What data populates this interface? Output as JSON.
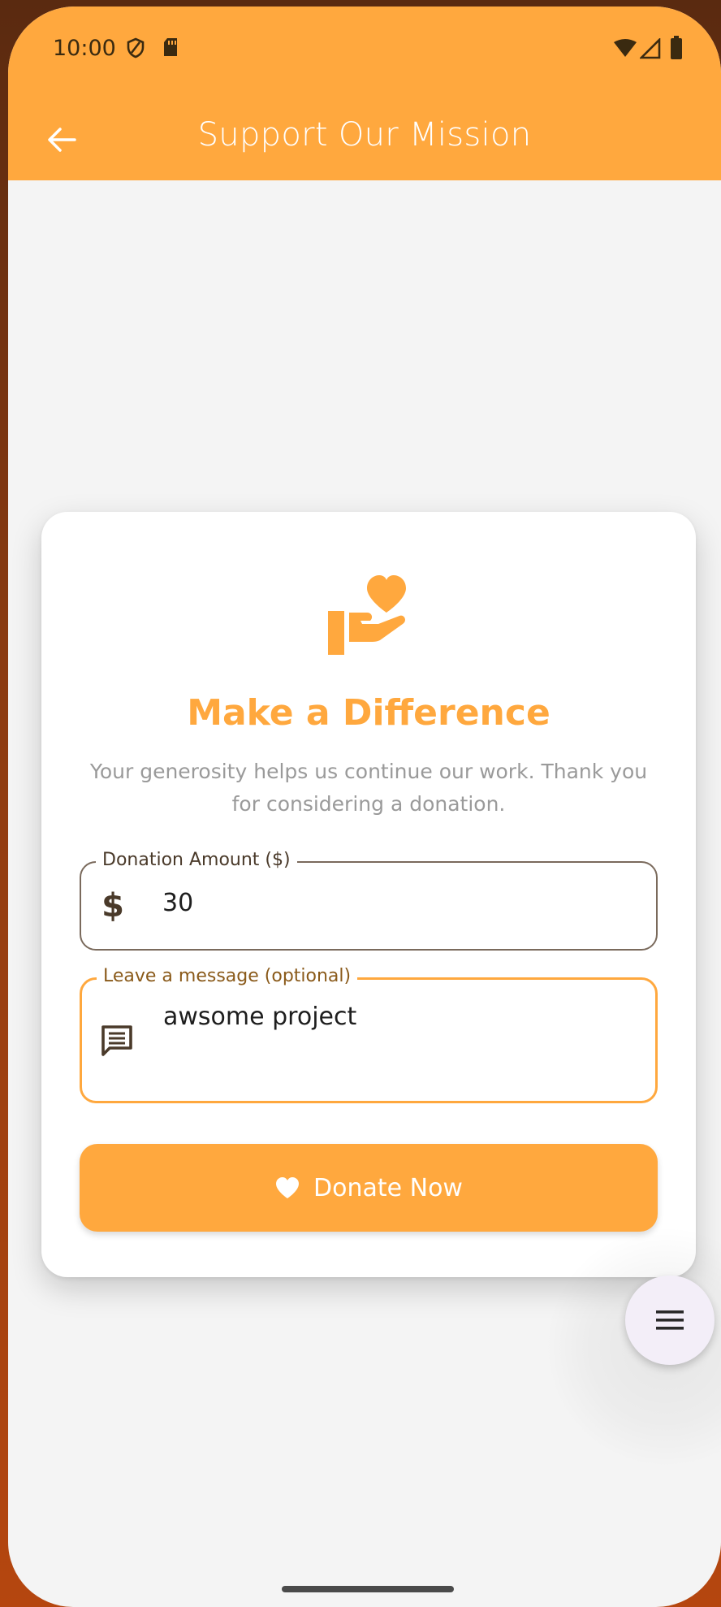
{
  "status_bar": {
    "time": "10:00"
  },
  "app_bar": {
    "title": "Support Our Mission",
    "background_color": "#ffa83e"
  },
  "card": {
    "hero_icon": "volunteer-heart-hand-icon",
    "heading": "Make a Difference",
    "subtitle": "Your generosity helps us continue our work. Thank you for considering a donation.",
    "amount_field": {
      "label": "Donation Amount ($)",
      "prefix_icon": "dollar-icon",
      "value": "30"
    },
    "message_field": {
      "label": "Leave a message (optional)",
      "prefix_icon": "message-icon",
      "value": "awsome project"
    },
    "donate_button": {
      "icon": "heart-icon",
      "label": "Donate Now"
    }
  },
  "fab": {
    "icon": "menu-icon"
  },
  "colors": {
    "accent": "#ffa83e",
    "background": "#f4f4f4",
    "card": "#ffffff"
  }
}
